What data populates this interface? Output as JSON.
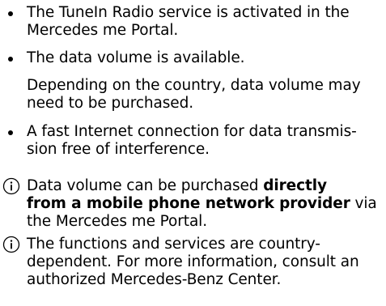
{
  "bullets": [
    {
      "text": "The TuneIn Radio service is activated in the\nMercedes me Portal."
    },
    {
      "text": "The data volume is available."
    },
    {
      "text": "A fast Internet connection for data transmis-\nsion free of interference."
    }
  ],
  "note_after_bullet_2": "Depending on the country, data volume may\nneed to be purchased.",
  "info_notes": [
    {
      "prefix": "Data volume can be purchased ",
      "bold": "directly\nfrom a mobile phone network provider",
      "suffix": " via\nthe Mercedes me Portal."
    },
    {
      "text": "The functions and services are country-\ndependent. For more information, consult an\nauthorized Mercedes-Benz Center."
    }
  ],
  "icon_color": "#000000"
}
